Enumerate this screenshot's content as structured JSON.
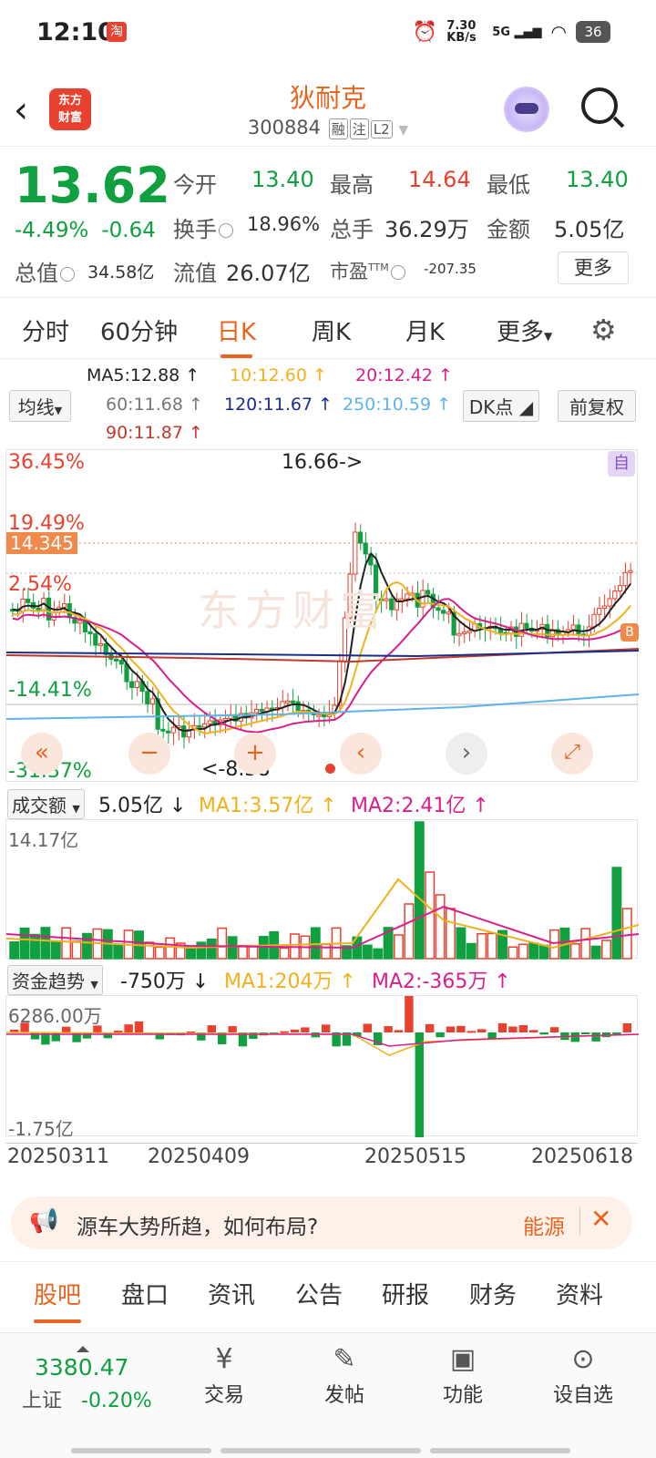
{
  "status": {
    "time": "12:10",
    "app_badge": "淘",
    "net_speed": "7.30 KB/s",
    "signal": "5G",
    "battery": "36"
  },
  "header": {
    "logo_line1": "东方",
    "logo_line2": "财富",
    "title": "狄耐克",
    "code": "300884",
    "tag1": "融",
    "tag2": "注",
    "tag3": "L2"
  },
  "quote": {
    "price": "13.62",
    "change_pct": "-4.49%",
    "change": "-0.64",
    "open_label": "今开",
    "open": "13.40",
    "high_label": "最高",
    "high": "14.64",
    "low_label": "最低",
    "low": "13.40",
    "turnover_label": "换手",
    "turnover": "18.96%",
    "volume_label": "总手",
    "volume": "36.29万",
    "amount_label": "金额",
    "amount": "5.05亿",
    "mktcap_label": "总值",
    "mktcap": "34.58亿",
    "float_label": "流值",
    "float": "26.07亿",
    "pe_label": "市盈",
    "pe_sup": "TTM",
    "pe": "-207.35",
    "more": "更多"
  },
  "tabs": [
    "分时",
    "60分钟",
    "日K",
    "周K",
    "月K",
    "更多"
  ],
  "ma": {
    "selector": "均线",
    "ma5": "MA5:12.88 ↑",
    "ma10": "10:12.60 ↑",
    "ma20": "20:12.42 ↑",
    "ma60": "60:11.68 ↑",
    "ma120": "120:11.67 ↑",
    "ma250": "250:10.59 ↑",
    "ma90": "90:11.87 ↑",
    "dk": "DK点",
    "adjust": "前复权"
  },
  "chart": {
    "pct_top": "36.45%",
    "pct_2": "19.49%",
    "price_marker": "14.345",
    "pct_3": "2.54%",
    "pct_4": "-14.41%",
    "pct_5": "-31.37%",
    "high_note": "16.66->",
    "low_note": "<-8.38",
    "self_tag": "自",
    "buy_tag": "B",
    "watermark": "东方财富",
    "colors": {
      "ma5": "#222222",
      "ma10": "#f0b21c",
      "ma20": "#d81f8c",
      "ma60": "#888888",
      "ma90": "#c0392b",
      "ma120": "#1a2f8a",
      "ma250": "#5db4e8",
      "up": "#e8412f",
      "down": "#10a040"
    }
  },
  "volume": {
    "selector": "成交额",
    "value": "5.05亿 ↓",
    "ma1": "MA1:3.57亿 ↑",
    "ma2": "MA2:2.41亿 ↑",
    "max": "14.17亿"
  },
  "funds": {
    "selector": "资金趋势",
    "value": "-750万 ↓",
    "ma1": "MA1:204万 ↑",
    "ma2": "MA2:-365万 ↑",
    "max": "6286.00万",
    "min": "-1.75亿"
  },
  "dates": [
    "20250311",
    "20250409",
    "20250515",
    "20250618"
  ],
  "news": {
    "text": "源车大势所趋，如何布局?",
    "tag": "能源"
  },
  "bottom_tabs": [
    "股吧",
    "盘口",
    "资讯",
    "公告",
    "研报",
    "财务",
    "资料"
  ],
  "index": {
    "value": "3380.47",
    "name": "上证",
    "change": "-0.20%"
  },
  "nav": [
    {
      "icon": "trade-icon",
      "label": "交易"
    },
    {
      "icon": "post-icon",
      "label": "发帖"
    },
    {
      "icon": "function-icon",
      "label": "功能"
    },
    {
      "icon": "watchlist-icon",
      "label": "设自选"
    }
  ]
}
